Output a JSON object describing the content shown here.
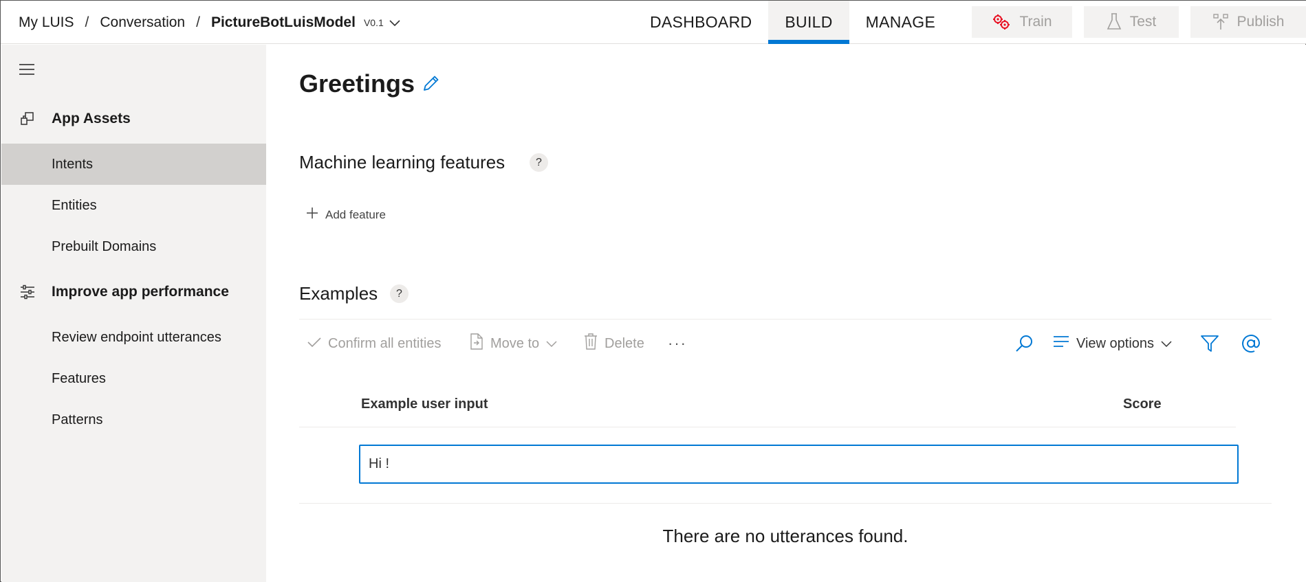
{
  "breadcrumb": {
    "root": "My LUIS",
    "category": "Conversation",
    "app_name": "PictureBotLuisModel",
    "version": "V0.1"
  },
  "nav_tabs": [
    {
      "label": "DASHBOARD",
      "active": false
    },
    {
      "label": "BUILD",
      "active": true
    },
    {
      "label": "MANAGE",
      "active": false
    }
  ],
  "actions": {
    "train": "Train",
    "test": "Test",
    "publish": "Publish"
  },
  "sidebar": {
    "groups": [
      {
        "label": "App Assets",
        "icon": "app-assets-icon",
        "items": [
          "Intents",
          "Entities",
          "Prebuilt Domains"
        ]
      },
      {
        "label": "Improve app performance",
        "icon": "sliders-icon",
        "items": [
          "Review endpoint utterances",
          "Features",
          "Patterns"
        ]
      }
    ],
    "selected": "Intents"
  },
  "page": {
    "title": "Greetings",
    "ml_section": "Machine learning features",
    "add_feature": "Add feature",
    "examples_section": "Examples",
    "help": "?"
  },
  "toolbar": {
    "confirm_all": "Confirm all entities",
    "move_to": "Move to",
    "delete": "Delete",
    "more": "···",
    "view_options": "View options"
  },
  "table": {
    "col_input": "Example user input",
    "col_score": "Score",
    "input_value": "Hi !",
    "empty": "There are no utterances found."
  },
  "colors": {
    "accent": "#0078d4",
    "train_icon": "#e81123",
    "sidebar_bg": "#f3f2f1",
    "selected_bg": "#d2d0ce"
  }
}
